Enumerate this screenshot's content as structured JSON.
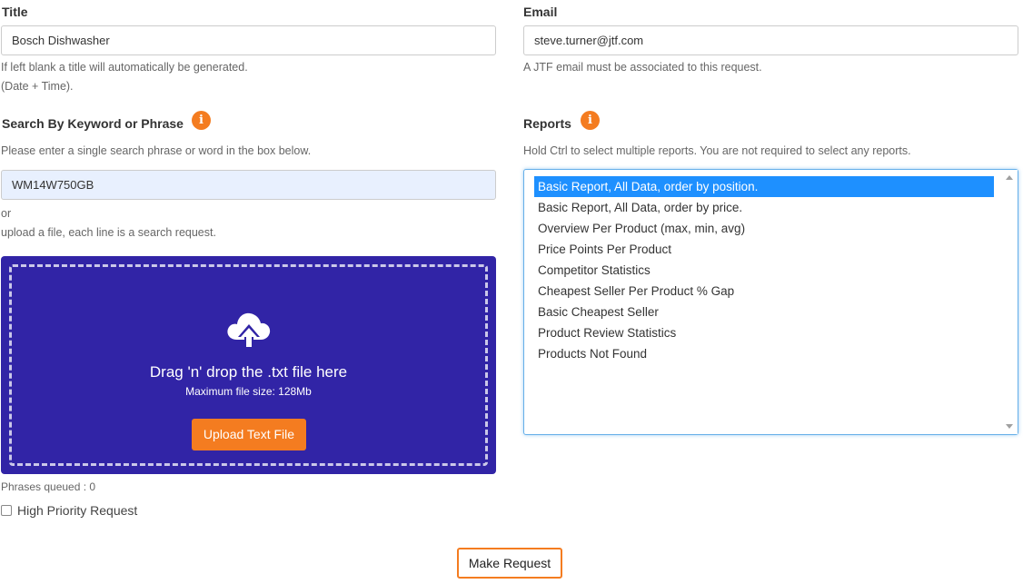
{
  "title_field": {
    "label": "Title",
    "value": "Bosch Dishwasher",
    "help_line1": "If left blank a title will automatically be generated.",
    "help_line2": "(Date + Time)."
  },
  "email_field": {
    "label": "Email",
    "value": "steve.turner@jtf.com",
    "help": "A JTF email must be associated to this request."
  },
  "search": {
    "label": "Search By Keyword or Phrase",
    "info_icon": "info-icon",
    "help": "Please enter a single search phrase or word in the box below.",
    "value": "WM14W750GB",
    "or_text": "or",
    "upload_hint": "upload a file, each line is a search request."
  },
  "dropzone": {
    "title": "Drag 'n' drop the .txt file here",
    "subtitle": "Maximum file size: 128Mb",
    "button_label": "Upload Text File",
    "icon": "cloud-upload-icon",
    "background_color": "#3124a6"
  },
  "phrases_queued": "Phrases queued : 0",
  "priority": {
    "label": "High Priority Request",
    "checked": false
  },
  "reports": {
    "label": "Reports",
    "info_icon": "info-icon",
    "help": "Hold Ctrl to select multiple reports. You are not required to select any reports.",
    "options": [
      {
        "label": "Basic Report, All Data, order by position.",
        "selected": true
      },
      {
        "label": "Basic Report, All Data, order by price.",
        "selected": false
      },
      {
        "label": "Overview Per Product (max, min, avg)",
        "selected": false
      },
      {
        "label": "Price Points Per Product",
        "selected": false
      },
      {
        "label": "Competitor Statistics",
        "selected": false
      },
      {
        "label": "Cheapest Seller Per Product % Gap",
        "selected": false
      },
      {
        "label": "Basic Cheapest Seller",
        "selected": false
      },
      {
        "label": "Product Review Statistics",
        "selected": false
      },
      {
        "label": "Products Not Found",
        "selected": false
      }
    ]
  },
  "submit": {
    "label": "Make Request"
  },
  "colors": {
    "accent": "#f47c20",
    "selection": "#1e90ff"
  }
}
